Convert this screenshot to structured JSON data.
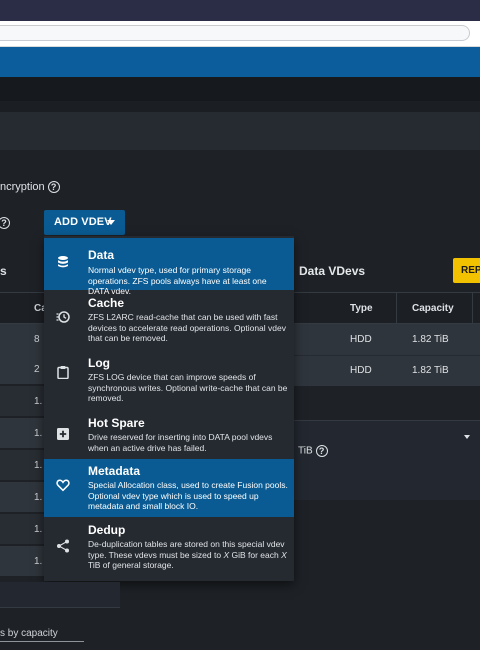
{
  "form": {
    "encryption_label": "ncryption",
    "help_symbol": "?",
    "add_vdev_label": "ADD VDEV",
    "left_tab_fragment": "s"
  },
  "left_table": {
    "header_fragment": "Ca",
    "values": [
      "8",
      "2",
      "1.",
      "1.",
      "1.",
      "1.",
      "1.",
      "1."
    ]
  },
  "right_table": {
    "title": "Data VDevs",
    "rep_button": "REP",
    "headers": {
      "type": "Type",
      "capacity": "Capacity"
    },
    "rows": [
      {
        "type": "HDD",
        "capacity": "1.82 TiB"
      },
      {
        "type": "HDD",
        "capacity": "1.82 TiB"
      }
    ],
    "tib_fragment": "TiB"
  },
  "menu": {
    "items": [
      {
        "title": "Data",
        "desc": "Normal vdev type, used for primary storage operations. ZFS pools always have at least one DATA vdev.",
        "icon": "database-icon",
        "selected": true
      },
      {
        "title": "Cache",
        "desc": "ZFS L2ARC read-cache that can be used with fast devices to accelerate read operations. Optional vdev that can be removed.",
        "icon": "cache-clock-icon",
        "selected": false
      },
      {
        "title": "Log",
        "desc": "ZFS LOG device that can improve speeds of synchronous writes. Optional write-cache that can be removed.",
        "icon": "clipboard-icon",
        "selected": false
      },
      {
        "title": "Hot Spare",
        "desc": "Drive reserved for inserting into DATA pool vdevs when an active drive has failed.",
        "icon": "plus-box-icon",
        "selected": false
      },
      {
        "title": "Metadata",
        "desc": "Special Allocation class, used to create Fusion pools. Optional vdev type which is used to speed up metadata and small block IO.",
        "icon": "heart-icon",
        "selected": true
      },
      {
        "title": "Dedup",
        "desc_before": "De-duplication tables are stored on this special vdev type. These vdevs must be sized to ",
        "desc_x1": "X",
        "desc_mid": " GiB for each ",
        "desc_x2": "X",
        "desc_after": " TiB of general storage.",
        "icon": "share-icon",
        "selected": false
      }
    ]
  },
  "footer": {
    "sort_text": "s by capacity"
  },
  "colors": {
    "accent": "#0a5b93",
    "topbar": "#0b5d9c",
    "warning": "#f2c200"
  }
}
